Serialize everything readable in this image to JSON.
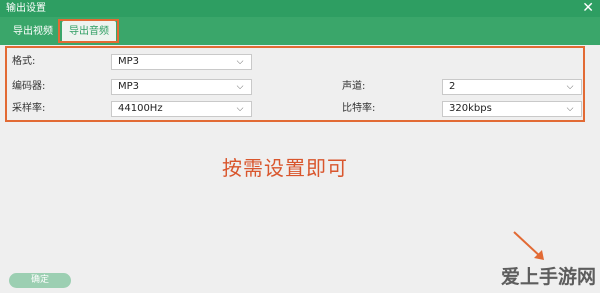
{
  "window": {
    "title": "输出设置",
    "close_glyph": "✕"
  },
  "tabs": [
    {
      "label": "导出视频",
      "active": false
    },
    {
      "label": "导出音频",
      "active": true
    }
  ],
  "settings": {
    "format": {
      "label": "格式:",
      "value": "MP3"
    },
    "encoder": {
      "label": "编码器:",
      "value": "MP3"
    },
    "channels": {
      "label": "声道:",
      "value": "2"
    },
    "sample_rate": {
      "label": "采样率:",
      "value": "44100Hz"
    },
    "bitrate": {
      "label": "比特率:",
      "value": "320kbps"
    }
  },
  "annotation": "按需设置即可",
  "confirm_button": "确定",
  "watermark": "爱上手游网",
  "colors": {
    "titlebar": "#2e9e62",
    "highlight": "#e26a34",
    "annotation": "#d9562d"
  },
  "icons": {
    "close": "close-icon",
    "dropdown": "chevron-down-icon",
    "arrow": "arrow-icon"
  }
}
